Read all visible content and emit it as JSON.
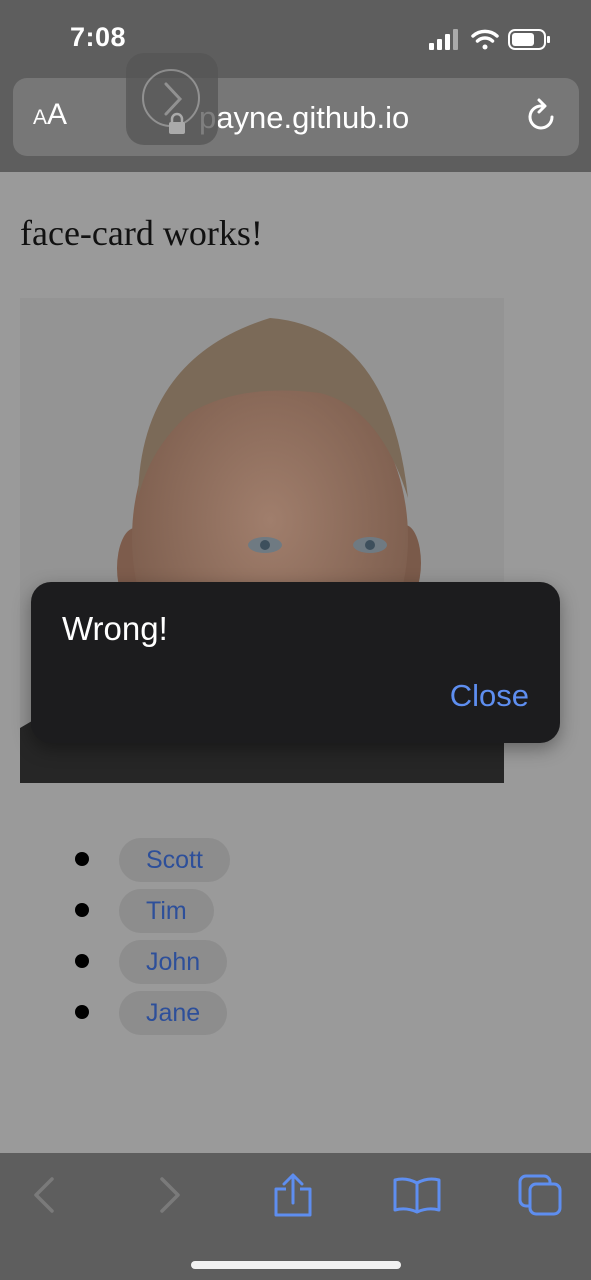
{
  "status_bar": {
    "time": "7:08",
    "icons": [
      "cellular-signal-icon",
      "wifi-icon",
      "battery-icon"
    ]
  },
  "browser": {
    "aa_small": "A",
    "aa_large": "A",
    "url": "payne.github.io",
    "icons": [
      "reload-icon",
      "lock-icon"
    ]
  },
  "page": {
    "heading": "face-card works!",
    "names": [
      "Scott",
      "Tim",
      "John",
      "Jane"
    ]
  },
  "alert": {
    "message": "Wrong!",
    "close_label": "Close"
  },
  "toolbar": {
    "icons": [
      "back-icon",
      "forward-icon",
      "share-icon",
      "bookmarks-icon",
      "tabs-icon"
    ]
  },
  "colors": {
    "link": "#2d4f9a",
    "accent": "#5e8ef0",
    "alert_bg": "#1c1c1e",
    "overlay_bg": "#9a9a9a"
  }
}
